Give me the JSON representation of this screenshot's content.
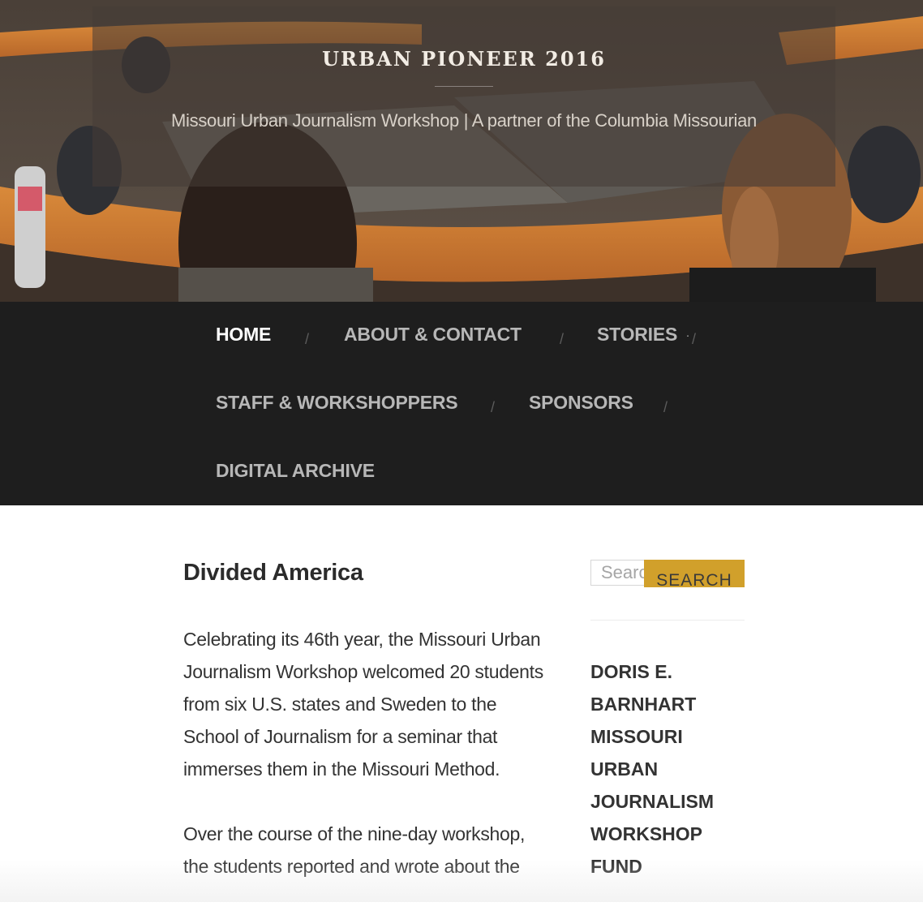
{
  "site": {
    "title": "URBAN PIONEER 2016",
    "description": "Missouri Urban Journalism Workshop | A partner of the Columbia Missourian"
  },
  "nav": {
    "items": [
      {
        "label": "HOME",
        "current": true
      },
      {
        "label": "ABOUT & CONTACT"
      },
      {
        "label": "STORIES",
        "has_submenu": true
      },
      {
        "label": "STAFF & WORKSHOPPERS"
      },
      {
        "label": "SPONSORS"
      },
      {
        "label": "DIGITAL ARCHIVE"
      }
    ],
    "separator": "/"
  },
  "post": {
    "title": "Divided America",
    "paragraphs": [
      "Celebrating its 46th year, the Missouri Urban Journalism Workshop welcomed 20 students from six U.S. states and Sweden to the School of Journalism for a seminar that immerses them in the Missouri Method.",
      "Over the course of the nine-day workshop, the students reported and wrote about the"
    ]
  },
  "sidebar": {
    "search": {
      "placeholder": "Search",
      "button_label": "SEARCH"
    },
    "widget_title": "DORIS E. BARNHART MISSOURI URBAN JOURNALISM WORKSHOP FUND"
  },
  "colors": {
    "nav_bg": "#1e1e1e",
    "accent": "#d1a02b",
    "text": "#333333"
  },
  "icons": {
    "submenu": "chevron-down-icon"
  }
}
